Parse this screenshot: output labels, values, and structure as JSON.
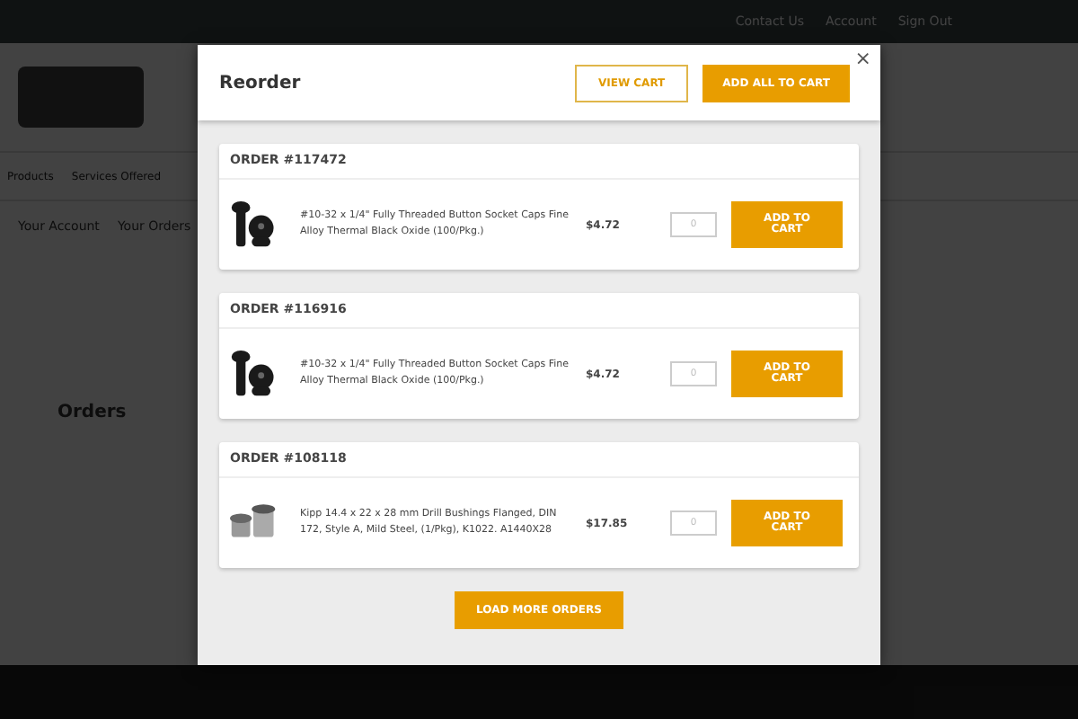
{
  "background": {
    "top_links": [
      "Contact Us",
      "Account",
      "Sign Out"
    ],
    "nav": [
      "Products",
      "Services Offered"
    ],
    "breadcrumb": [
      "Your Account",
      "Your Orders"
    ],
    "heading": "Orders"
  },
  "modal": {
    "title": "Reorder",
    "view_cart": "VIEW CART",
    "add_all": "ADD ALL TO CART",
    "close": "×",
    "orders": [
      {
        "number": "ORDER #117472",
        "product": "#10-32 x 1/4\" Fully Threaded Button Socket Caps Fine Alloy Thermal Black Oxide (100/Pkg.)",
        "kind": "screw",
        "price": "$4.72",
        "quantity_placeholder": "0",
        "button": "ADD TO CART"
      },
      {
        "number": "ORDER #116916",
        "product": "#10-32 x 1/4\" Fully Threaded Button Socket Caps Fine Alloy Thermal Black Oxide (100/Pkg.)",
        "kind": "screw",
        "price": "$4.72",
        "quantity_placeholder": "0",
        "button": "ADD TO CART"
      },
      {
        "number": "ORDER #108118",
        "product": "Kipp 14.4 x 22 x 28 mm Drill Bushings Flanged, DIN 172, Style A, Mild Steel, (1/Pkg), K1022. A1440X28",
        "kind": "bushing",
        "price": "$17.85",
        "quantity_placeholder": "0",
        "button": "ADD TO CART"
      }
    ],
    "load_more": "LOAD MORE ORDERS"
  }
}
